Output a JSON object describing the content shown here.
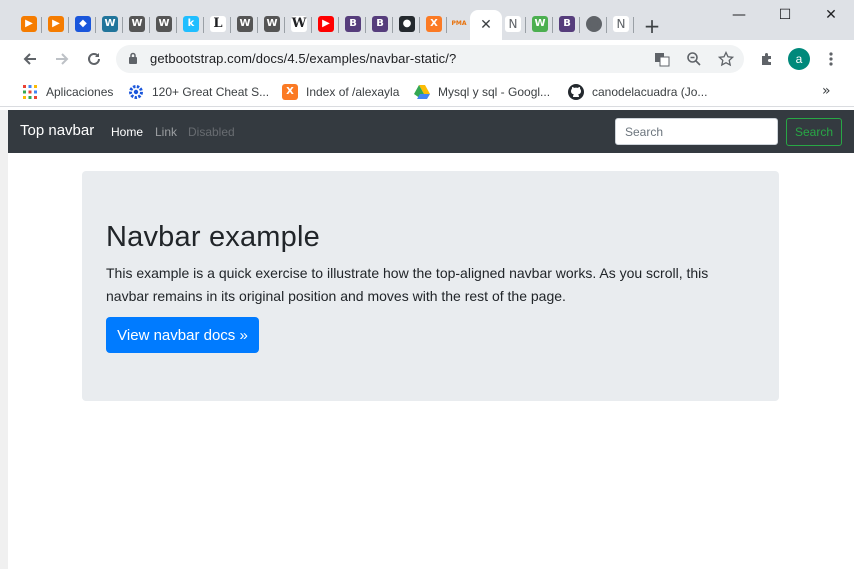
{
  "browser": {
    "tabs": [
      {
        "icon": "pmq-orange-icon",
        "color": "#f57c00",
        "glyph": "▶"
      },
      {
        "icon": "pmq-orange-icon",
        "color": "#f57c00",
        "glyph": "▶"
      },
      {
        "icon": "blue-diamond-icon",
        "color": "#1a56db",
        "glyph": "◆"
      },
      {
        "icon": "wordpress-icon",
        "color": "#21759b",
        "glyph": "W"
      },
      {
        "icon": "wordpress-icon",
        "color": "#555555",
        "glyph": "W"
      },
      {
        "icon": "wordpress-icon",
        "color": "#555555",
        "glyph": "W"
      },
      {
        "icon": "kaggle-icon",
        "color": "#20beff",
        "glyph": "k"
      },
      {
        "icon": "letter-l-icon",
        "color": "#ffffff",
        "glyph": "L"
      },
      {
        "icon": "wordpress-icon",
        "color": "#555555",
        "glyph": "W"
      },
      {
        "icon": "wordpress-icon",
        "color": "#555555",
        "glyph": "W"
      },
      {
        "icon": "wikipedia-icon",
        "color": "#ffffff",
        "glyph": "W"
      },
      {
        "icon": "youtube-icon",
        "color": "#ff0000",
        "glyph": "▶"
      },
      {
        "icon": "bootstrap-icon",
        "color": "#563d7c",
        "glyph": "B"
      },
      {
        "icon": "bootstrap-icon",
        "color": "#563d7c",
        "glyph": "B"
      },
      {
        "icon": "github-icon",
        "color": "#24292e",
        "glyph": "●"
      },
      {
        "icon": "xampp-icon",
        "color": "#fb7a24",
        "glyph": "X"
      },
      {
        "icon": "phpmyadmin-icon",
        "color": "#f89c0e",
        "glyph": "PMA"
      }
    ],
    "active_tab_close": "✕",
    "after_tabs": [
      {
        "icon": "letter-n-icon",
        "color": "#ffffff",
        "glyph": "N"
      },
      {
        "icon": "w3-icon",
        "color": "#4caf50",
        "glyph": "W"
      },
      {
        "icon": "bootstrap-icon",
        "color": "#563d7c",
        "glyph": "B"
      },
      {
        "icon": "globe-icon",
        "color": "#5f6368",
        "glyph": "●"
      },
      {
        "icon": "letter-n-icon",
        "color": "#ffffff",
        "glyph": "N"
      }
    ],
    "new_tab": "+",
    "window_controls": {
      "minimize": "—",
      "maximize": "☐",
      "close": "✕"
    },
    "url": "getbootstrap.com/docs/4.5/examples/navbar-static/?",
    "avatar_letter": "a"
  },
  "bookmarks": [
    {
      "icon": "apps-grid-icon",
      "label": "Aplicaciones"
    },
    {
      "icon": "gear-blue-icon",
      "label": "120+ Great Cheat S..."
    },
    {
      "icon": "xampp-icon",
      "label": "Index of /alexayla"
    },
    {
      "icon": "google-drive-icon",
      "label": "Mysql y sql - Googl..."
    },
    {
      "icon": "github-icon",
      "label": "canodelacuadra (Jo..."
    }
  ],
  "bookmarks_more": "»",
  "navbar": {
    "brand": "Top navbar",
    "links": [
      "Home",
      "Link",
      "Disabled"
    ],
    "search_placeholder": "Search",
    "search_button": "Search"
  },
  "jumbotron": {
    "title": "Navbar example",
    "text": "This example is a quick exercise to illustrate how the top-aligned navbar works. As you scroll, this navbar remains in its original position and moves with the rest of the page.",
    "button": "View navbar docs »"
  },
  "colors": {
    "navbar_bg": "#343a40",
    "jumbotron_bg": "#e9ecef",
    "primary": "#007bff",
    "success": "#28a745"
  }
}
